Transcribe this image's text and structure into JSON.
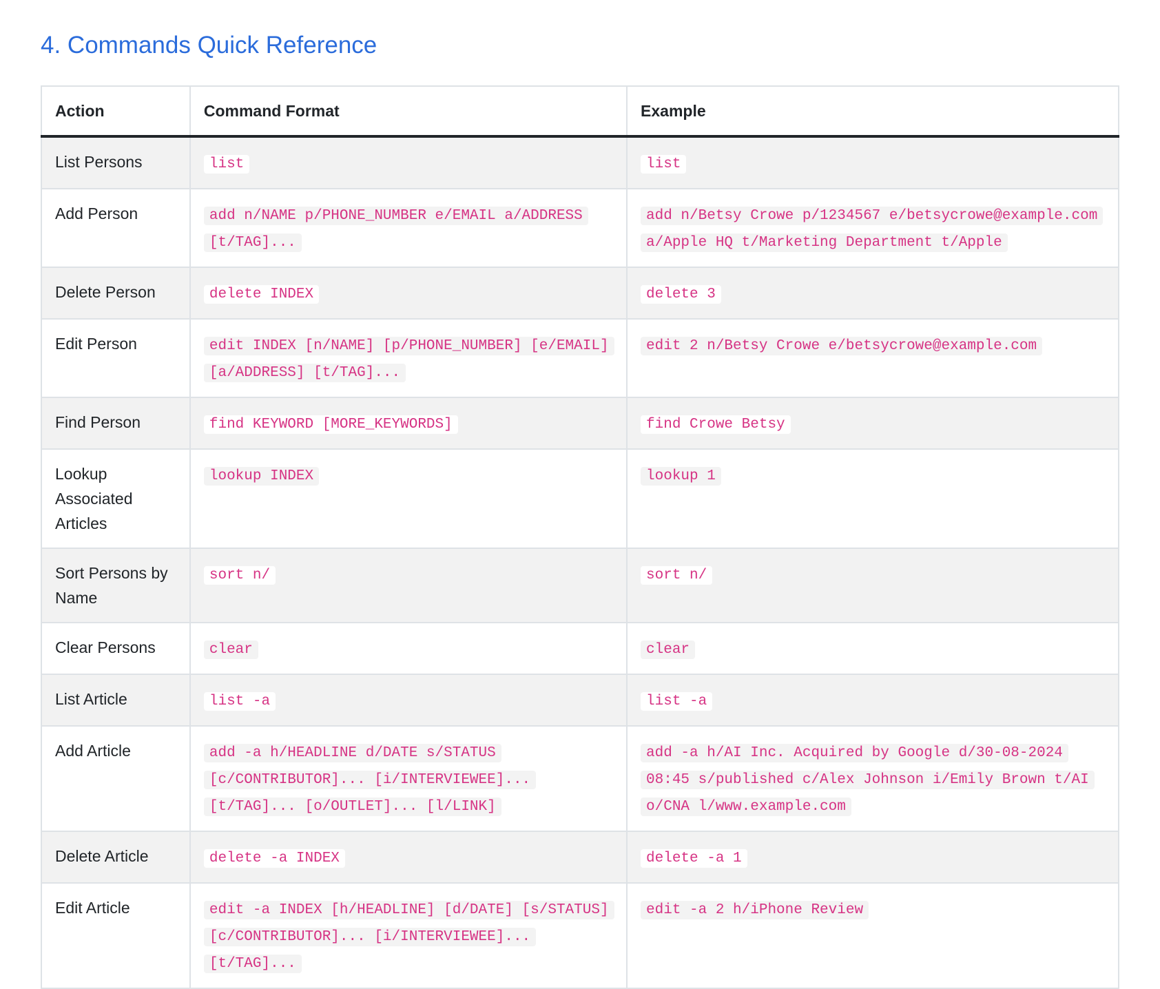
{
  "title": "4. Commands Quick Reference",
  "table": {
    "headers": [
      "Action",
      "Command Format",
      "Example"
    ],
    "rows": [
      {
        "action": "List Persons",
        "format": "list",
        "example": "list"
      },
      {
        "action": "Add Person",
        "format": "add n/NAME p/PHONE_NUMBER e/EMAIL a/ADDRESS [t/TAG]...",
        "example": "add n/Betsy Crowe p/1234567 e/betsycrowe@example.com a/Apple HQ t/Marketing Department t/Apple"
      },
      {
        "action": "Delete Person",
        "format": "delete INDEX",
        "example": "delete 3"
      },
      {
        "action": "Edit Person",
        "format": "edit INDEX [n/NAME] [p/PHONE_NUMBER] [e/EMAIL] [a/ADDRESS] [t/TAG]...",
        "example": "edit 2 n/Betsy Crowe e/betsycrowe@example.com"
      },
      {
        "action": "Find Person",
        "format": "find KEYWORD [MORE_KEYWORDS]",
        "example": "find Crowe Betsy"
      },
      {
        "action": "Lookup Associated Articles",
        "format": "lookup INDEX",
        "example": "lookup 1"
      },
      {
        "action": "Sort Persons by Name",
        "format": "sort n/",
        "example": "sort n/"
      },
      {
        "action": "Clear Persons",
        "format": "clear",
        "example": "clear"
      },
      {
        "action": "List Article",
        "format": "list -a",
        "example": "list -a"
      },
      {
        "action": "Add Article",
        "format": "add -a h/HEADLINE d/DATE s/STATUS [c/CONTRIBUTOR]... [i/INTERVIEWEE]... [t/TAG]... [o/OUTLET]... [l/LINK]",
        "example": "add -a h/AI Inc. Acquired by Google d/30-08-2024 08:45 s/published c/Alex Johnson i/Emily Brown t/AI o/CNA l/www.example.com"
      },
      {
        "action": "Delete Article",
        "format": "delete -a INDEX",
        "example": "delete -a 1"
      },
      {
        "action": "Edit Article",
        "format": "edit -a INDEX [h/HEADLINE] [d/DATE] [s/STATUS] [c/CONTRIBUTOR]... [i/INTERVIEWEE]... [t/TAG]...",
        "example": "edit -a 2 h/iPhone Review"
      }
    ]
  }
}
